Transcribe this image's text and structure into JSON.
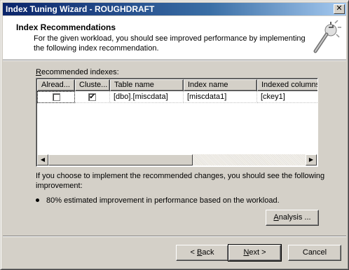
{
  "window": {
    "title": "Index Tuning Wizard - ROUGHDRAFT",
    "close_glyph": "✕"
  },
  "header": {
    "title": "Index Recommendations",
    "description": "For the given workload,  you should see improved performance by implementing the following index recommendation.",
    "icon": "wand-icon"
  },
  "recommended": {
    "label_accel": "R",
    "label_rest": "ecommended indexes:",
    "columns": [
      "Alread...",
      "Cluste...",
      "Table name",
      "Index name",
      "Indexed columns"
    ],
    "rows": [
      {
        "already": false,
        "clustered": true,
        "table": "[dbo].[miscdata]",
        "index": "[miscdata1]",
        "columns": "[ckey1]"
      }
    ]
  },
  "scrollbar": {
    "left_glyph": "◀",
    "right_glyph": "▶"
  },
  "info": {
    "text": "If you choose to implement the recommended changes, you should see the following improvement:",
    "bullet": "80% estimated improvement in performance based on the workload."
  },
  "buttons": {
    "analysis_accel": "A",
    "analysis_rest": "nalysis ...",
    "back_prefix": "< ",
    "back_accel": "B",
    "back_rest": "ack",
    "next_accel": "N",
    "next_rest": "ext >",
    "cancel": "Cancel"
  },
  "checkmark": "✔"
}
